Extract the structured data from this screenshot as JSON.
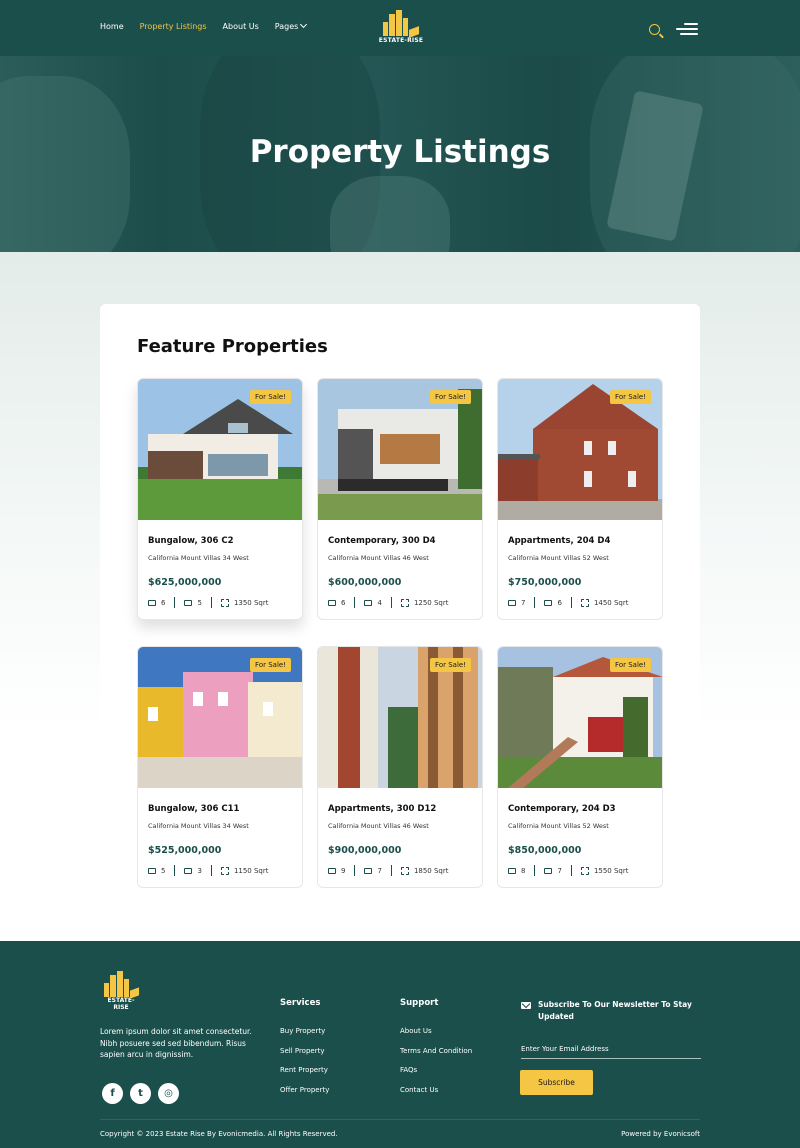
{
  "brand": {
    "name": "ESTATE-RISE",
    "logo_color": "#f5c544",
    "primary_color": "#1b4f4c"
  },
  "nav": {
    "items": [
      "Home",
      "Property Listings",
      "About Us",
      "Pages"
    ],
    "active": "Property Listings"
  },
  "hero": {
    "title": "Property Listings"
  },
  "section": {
    "title": "Feature Properties"
  },
  "properties": [
    {
      "badge": "For Sale!",
      "name": "Bungalow, 306 C2",
      "address": "California Mount Villas 34 West",
      "price": "$625,000,000",
      "beds": "6",
      "baths": "5",
      "area": "1350 Sqrt"
    },
    {
      "badge": "For Sale!",
      "name": "Contemporary, 300 D4",
      "address": "California Mount Villas 46 West",
      "price": "$600,000,000",
      "beds": "6",
      "baths": "4",
      "area": "1250 Sqrt"
    },
    {
      "badge": "For Sale!",
      "name": "Appartments, 204 D4",
      "address": "California Mount Villas 52 West",
      "price": "$750,000,000",
      "beds": "7",
      "baths": "6",
      "area": "1450 Sqrt"
    },
    {
      "badge": "For Sale!",
      "name": "Bungalow, 306 C11",
      "address": "California Mount Villas 34 West",
      "price": "$525,000,000",
      "beds": "5",
      "baths": "3",
      "area": "1150 Sqrt"
    },
    {
      "badge": "For Sale!",
      "name": "Appartments, 300 D12",
      "address": "California Mount Villas 46 West",
      "price": "$900,000,000",
      "beds": "9",
      "baths": "7",
      "area": "1850 Sqrt"
    },
    {
      "badge": "For Sale!",
      "name": "Contemporary, 204 D3",
      "address": "California Mount Villas 52 West",
      "price": "$850,000,000",
      "beds": "8",
      "baths": "7",
      "area": "1550 Sqrt"
    }
  ],
  "footer": {
    "about": "Lorem ipsum dolor sit amet consectetur. Nibh posuere sed sed bibendum. Risus sapien arcu in dignissim.",
    "services": {
      "title": "Services",
      "links": [
        "Buy Property",
        "Sell Property",
        "Rent Property",
        "Offer Property"
      ]
    },
    "support": {
      "title": "Support",
      "links": [
        "About Us",
        "Terms And Condition",
        "FAQs",
        "Contact Us"
      ]
    },
    "newsletter": {
      "title": "Subscribe To Our Newsletter To Stay Updated",
      "placeholder": "Enter Your Email Address",
      "button": "Subscribe"
    },
    "copyright": "Copyright © 2023 Estate Rise By Evonicmedia. All Rights Reserved.",
    "powered": "Powered by Evonicsoft",
    "socials": [
      "facebook-icon",
      "twitter-icon",
      "instagram-icon"
    ]
  }
}
